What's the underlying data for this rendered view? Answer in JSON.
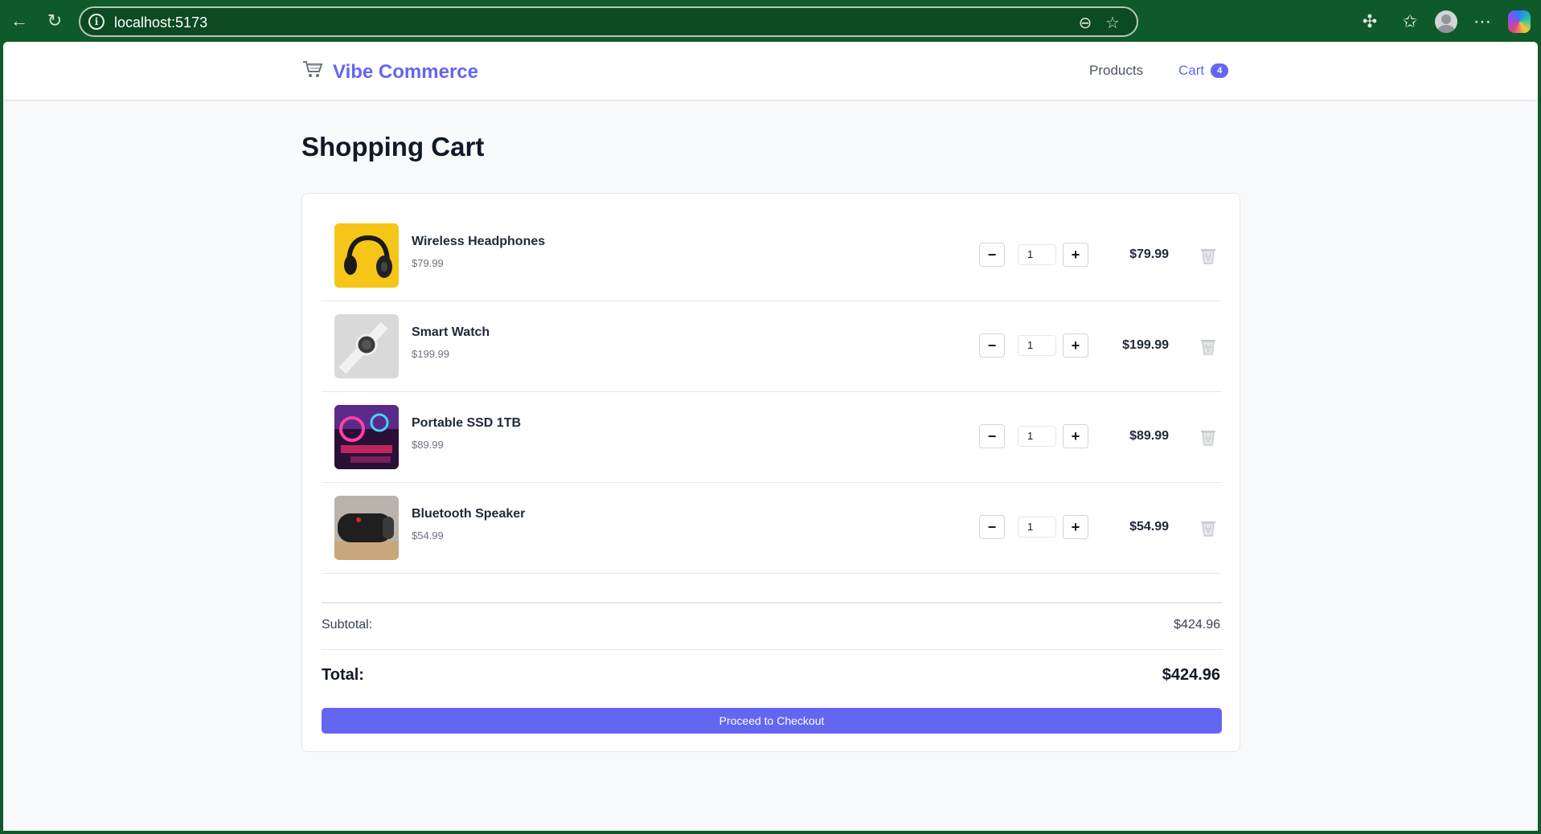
{
  "browser": {
    "url": "localhost:5173",
    "icons": [
      "back-arrow-icon",
      "reload-icon",
      "site-info-icon",
      "zoom-out-icon",
      "favorite-star-icon",
      "extensions-icon",
      "favorites-icon",
      "profile-icon",
      "more-icon",
      "copilot-icon"
    ]
  },
  "header": {
    "brand": "Vibe Commerce",
    "nav": {
      "products": "Products",
      "cart": "Cart",
      "cart_count": "4"
    }
  },
  "page": {
    "title": "Shopping Cart"
  },
  "cart": {
    "items": [
      {
        "name": "Wireless Headphones",
        "unit_price": "$79.99",
        "quantity": "1",
        "line_total": "$79.99"
      },
      {
        "name": "Smart Watch",
        "unit_price": "$199.99",
        "quantity": "1",
        "line_total": "$199.99"
      },
      {
        "name": "Portable SSD 1TB",
        "unit_price": "$89.99",
        "quantity": "1",
        "line_total": "$89.99"
      },
      {
        "name": "Bluetooth Speaker",
        "unit_price": "$54.99",
        "quantity": "1",
        "line_total": "$54.99"
      }
    ],
    "minus": "−",
    "plus": "+"
  },
  "summary": {
    "subtotal_label": "Subtotal:",
    "subtotal_value": "$424.96",
    "total_label": "Total:",
    "total_value": "$424.96",
    "checkout_label": "Proceed to Checkout"
  },
  "colors": {
    "accent": "#6366f1",
    "chrome": "#0f5a2a"
  }
}
